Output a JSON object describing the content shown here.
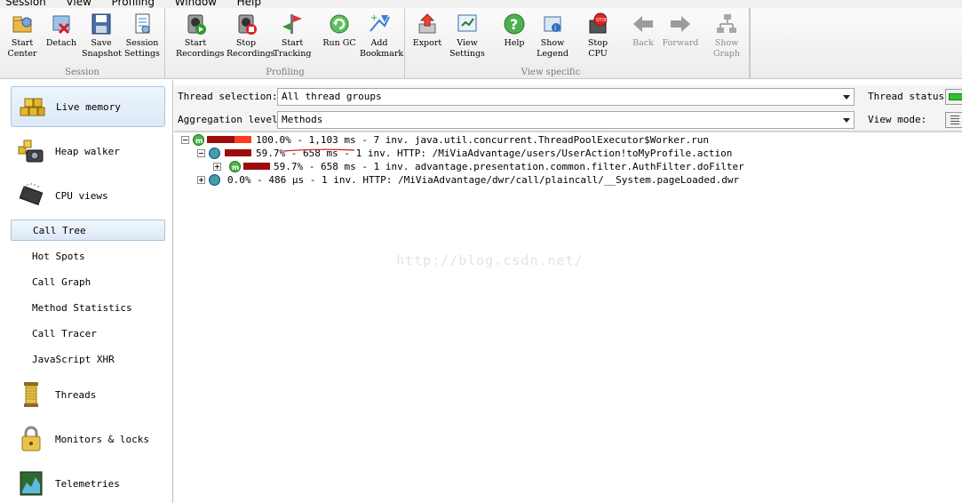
{
  "menu": [
    "Session",
    "View",
    "Profiling",
    "Window",
    "Help"
  ],
  "toolbar": {
    "groups": [
      {
        "label": "Session",
        "buttons": [
          {
            "label": "Start\nCenter",
            "icon": "start-center-icon"
          },
          {
            "label": "Detach",
            "icon": "detach-icon"
          },
          {
            "label": "Save\nSnapshot",
            "icon": "save-snapshot-icon"
          },
          {
            "label": "Session\nSettings",
            "icon": "session-settings-icon"
          }
        ]
      },
      {
        "label": "Profiling",
        "buttons": [
          {
            "label": "Start\nRecordings",
            "icon": "start-recordings-icon"
          },
          {
            "label": "Stop\nRecordings",
            "icon": "stop-recordings-icon"
          },
          {
            "label": "Start\nTracking",
            "icon": "start-tracking-icon"
          },
          {
            "label": "Run GC",
            "icon": "run-gc-icon"
          },
          {
            "label": "Add\nBookmark",
            "icon": "add-bookmark-icon"
          }
        ]
      },
      {
        "label": "View specific",
        "buttons": [
          {
            "label": "Export",
            "icon": "export-icon"
          },
          {
            "label": "View\nSettings",
            "icon": "view-settings-icon"
          },
          {
            "label": "Help",
            "icon": "help-icon"
          },
          {
            "label": "Show\nLegend",
            "icon": "show-legend-icon"
          },
          {
            "label": "Stop\nCPU",
            "icon": "stop-cpu-icon"
          },
          {
            "label": "Back",
            "icon": "back-icon"
          },
          {
            "label": "Forward",
            "icon": "forward-icon"
          },
          {
            "label": "Show\nGraph",
            "icon": "show-graph-icon"
          }
        ]
      }
    ]
  },
  "sidebar": {
    "live_memory": "Live memory",
    "heap_walker": "Heap walker",
    "cpu_views": "CPU views",
    "sub": [
      "Call Tree",
      "Hot Spots",
      "Call Graph",
      "Method Statistics",
      "Call Tracer",
      "JavaScript XHR"
    ],
    "threads": "Threads",
    "monitors": "Monitors & locks",
    "telemetries": "Telemetries"
  },
  "options": {
    "thread_selection_label": "Thread selection:",
    "thread_selection_value": "All thread groups",
    "aggregation_label": "Aggregation level:",
    "aggregation_value": "Methods",
    "thread_status_label": "Thread status:",
    "view_mode_label": "View mode:"
  },
  "tree": [
    {
      "text": "100.0% - 1,103 ms - 7 inv. java.util.concurrent.ThreadPoolExecutor$Worker.run",
      "percent": 100.0
    },
    {
      "text": "59.7% - 658 ms - 1 inv. HTTP: /MiViaAdvantage/users/UserAction!toMyProfile.action",
      "percent": 59.7
    },
    {
      "text": "59.7% - 658 ms - 1 inv. advantage.presentation.common.filter.AuthFilter.doFilter",
      "percent": 59.7
    },
    {
      "text": "0.0% - 486 µs - 1 inv. HTTP: /MiViaAdvantage/dwr/call/plaincall/__System.pageLoaded.dwr",
      "percent": 0.0
    }
  ],
  "watermark": "http://blog.csdn.net/",
  "colors": {
    "bar": "#9e0b0b",
    "bar_hot": "#ff3b1f",
    "selection": "#dce9f6"
  }
}
